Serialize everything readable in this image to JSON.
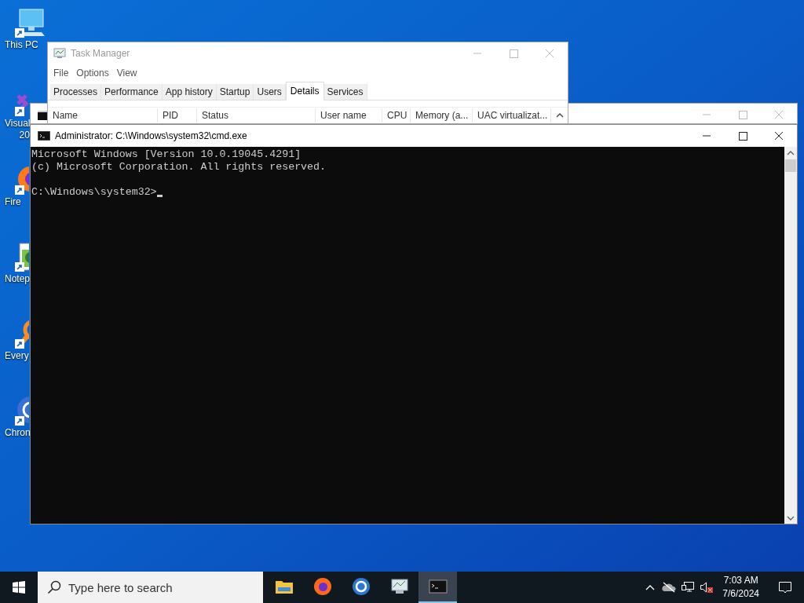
{
  "desktop_icons": [
    {
      "lines": [
        "This PC"
      ],
      "kind": "pc"
    },
    {
      "lines": [
        "Visual",
        "20"
      ],
      "kind": "vs"
    },
    {
      "lines": [
        "Fire"
      ],
      "kind": "firefox"
    },
    {
      "lines": [
        "Notep"
      ],
      "kind": "notepad"
    },
    {
      "lines": [
        "Every"
      ],
      "kind": "everything"
    },
    {
      "lines": [
        "Chron"
      ],
      "kind": "chrome"
    }
  ],
  "task_manager": {
    "title": "Task Manager",
    "menu": [
      "File",
      "Options",
      "View"
    ],
    "tabs": [
      {
        "label": "Processes",
        "selected": false
      },
      {
        "label": "Performance",
        "selected": false
      },
      {
        "label": "App history",
        "selected": false
      },
      {
        "label": "Startup",
        "selected": false
      },
      {
        "label": "Users",
        "selected": false
      },
      {
        "label": "Details",
        "selected": true
      },
      {
        "label": "Services",
        "selected": false
      }
    ],
    "columns": [
      "Name",
      "PID",
      "Status",
      "User name",
      "CPU",
      "Memory (a...",
      "UAC virtualizat..."
    ]
  },
  "cmd_window": {
    "title": "Administrator: C:\\Windows\\system32\\cmd.exe",
    "lines": [
      "Microsoft Windows [Version 10.0.19045.4291]",
      "(c) Microsoft Corporation. All rights reserved."
    ],
    "prompt": "C:\\Windows\\system32>"
  },
  "taskbar": {
    "search": {
      "placeholder": "Type here to search"
    },
    "apps": [
      {
        "kind": "explorer",
        "active": false
      },
      {
        "kind": "firefox",
        "active": false
      },
      {
        "kind": "chrome",
        "active": false
      },
      {
        "kind": "taskmgr",
        "active": false
      },
      {
        "kind": "cmd",
        "active": true
      }
    ],
    "time": "7:03 AM",
    "date": "7/6/2024"
  }
}
